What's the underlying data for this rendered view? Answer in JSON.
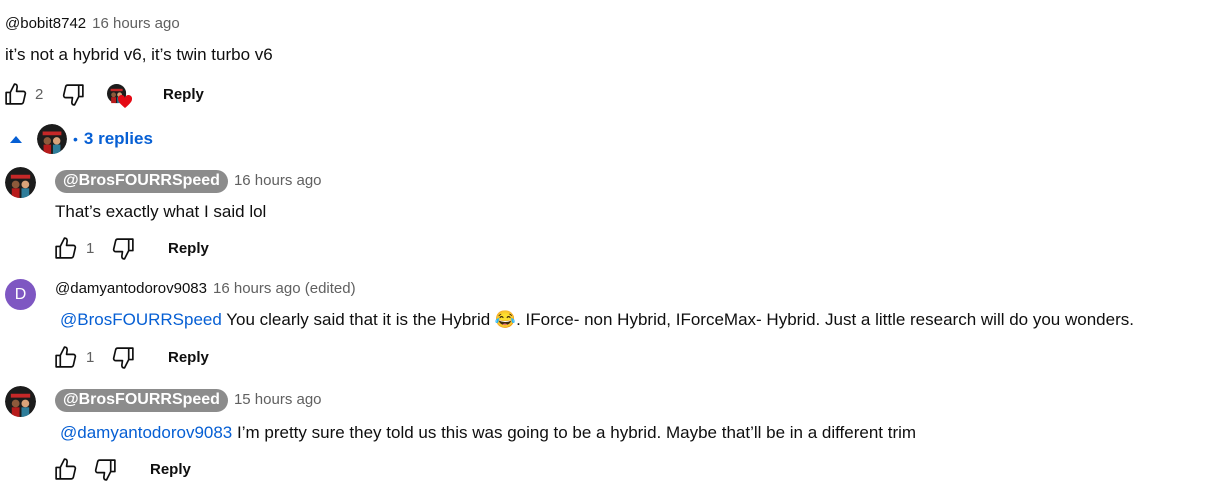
{
  "comment": {
    "author": "@bobit8742",
    "time": "16 hours ago",
    "text": "it’s not a hybrid v6, it’s twin turbo v6",
    "likes": "2",
    "reply_label": "Reply",
    "replies_toggle": "3 replies"
  },
  "replies": [
    {
      "author": "@BrosFOURRSpeed",
      "time": "16 hours ago",
      "text": "That’s exactly what I said lol",
      "likes": "1",
      "reply_label": "Reply"
    },
    {
      "author": "@damyantodorov9083",
      "avatar_letter": "D",
      "time": "16 hours ago (edited)",
      "mention": "@BrosFOURRSpeed",
      "text_a": " You clearly said that it is the Hybrid ",
      "emoji": "😂",
      "text_b": ". IForce- non Hybrid, IForceMax- Hybrid. Just a little research will do you wonders.",
      "likes": "1",
      "reply_label": "Reply"
    },
    {
      "author": "@BrosFOURRSpeed",
      "time": "15 hours ago",
      "mention": "@damyantodorov9083",
      "text": " I’m pretty sure they told us this was going to be a hybrid. Maybe that’ll be in a different trim",
      "reply_label": "Reply"
    }
  ],
  "colors": {
    "link": "#065fd4",
    "pill": "#8c8c8c",
    "avatar_d": "#7e57c2",
    "heart": "#e50914"
  },
  "icons": [
    "like-icon",
    "dislike-icon",
    "creator-heart-icon",
    "caret-up-icon"
  ]
}
